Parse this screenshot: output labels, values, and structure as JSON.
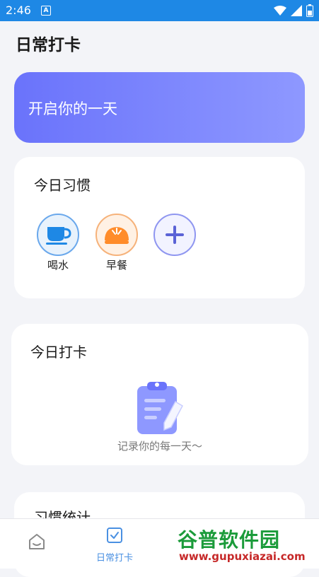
{
  "status_bar": {
    "time": "2:46",
    "notification_icon": "a-notification-icon",
    "icons": [
      "wifi-icon",
      "signal-icon",
      "battery-icon"
    ]
  },
  "header": {
    "title": "日常打卡"
  },
  "banner": {
    "text": "开启你的一天"
  },
  "habits_card": {
    "title": "今日习惯",
    "items": [
      {
        "label": "喝水",
        "icon": "cup-icon",
        "color": "#4a90e2"
      },
      {
        "label": "早餐",
        "icon": "bun-icon",
        "color": "#f5a05a"
      }
    ],
    "add_icon": "plus-icon"
  },
  "checkin_card": {
    "title": "今日打卡",
    "empty_text": "记录你的每一天～",
    "empty_icon": "clipboard-icon"
  },
  "stats_card": {
    "title": "习惯统计"
  },
  "tabbar": {
    "tabs": [
      {
        "label": "",
        "icon": "home-icon",
        "active": false
      },
      {
        "label": "日常打卡",
        "icon": "checkbox-icon",
        "active": true
      }
    ],
    "active_color": "#4a90e2"
  },
  "watermark": {
    "brand": "谷普软件园",
    "url": "www.gupuxiazai.com"
  }
}
